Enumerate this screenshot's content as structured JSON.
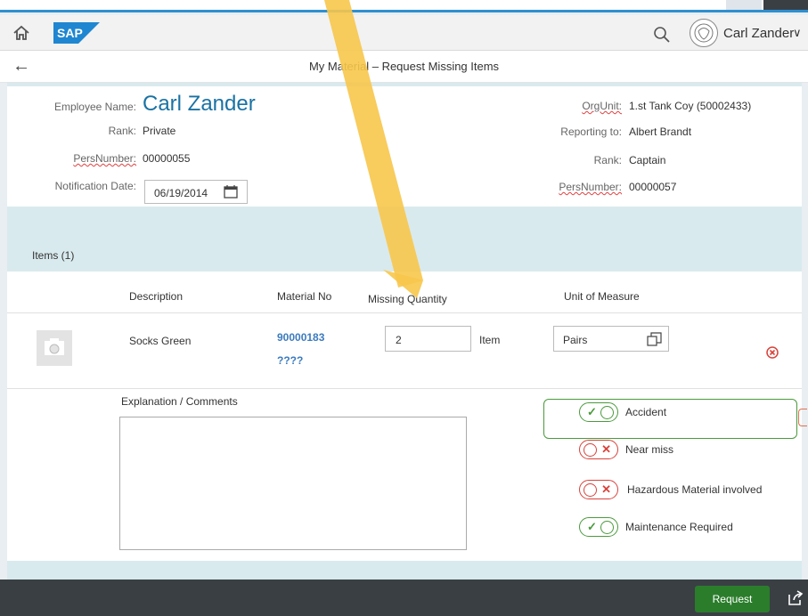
{
  "shell": {
    "logo_text": "SAP",
    "user_name": "Carl Zander",
    "user_menu_chevron": "∨",
    "back_glyph": "←",
    "home_glyph": "⌂"
  },
  "page": {
    "title": "My Material – Request Missing Items"
  },
  "employee": {
    "name_label": "Employee Name:",
    "name_value": "Carl Zander",
    "rank_label": "Rank:",
    "rank_value": "Private",
    "pers_label": "PersNumber:",
    "pers_value": "00000055",
    "date_label": "Notification Date:",
    "date_value": "06/19/2014"
  },
  "manager": {
    "orgunit_label": "OrgUnit:",
    "orgunit_value": "1.st Tank Coy (50002433)",
    "reporting_label": "Reporting to:",
    "reporting_value": "Albert Brandt",
    "rank_label": "Rank:",
    "rank_value": "Captain",
    "pers_label": "PersNumber:",
    "pers_value": "00000057"
  },
  "items": {
    "title": "Items (1)",
    "columns": [
      "Description",
      "Material No",
      "Missing Quantity",
      "Unit of Measure"
    ],
    "rows": [
      {
        "description": "Socks Green",
        "material_no": "90000183",
        "material_sub": "????",
        "quantity": "2",
        "quantity_unit": "Item",
        "uom": "Pairs"
      }
    ]
  },
  "explanation": {
    "label": "Explanation / Comments",
    "value": ""
  },
  "flags": [
    {
      "label": "Accident",
      "state": "on"
    },
    {
      "label": "Near miss",
      "state": "off"
    },
    {
      "label": "Hazardous Material involved",
      "state": "off"
    },
    {
      "label": "Maintenance Required",
      "state": "on"
    }
  ],
  "footer": {
    "request_label": "Request"
  },
  "colors": {
    "accent": "#1a72a3",
    "link": "#3b7bbf",
    "on": "#4a9a3c",
    "off": "#d9423b",
    "footer": "#3a3f44",
    "request": "#2b7d2b",
    "highlight": "#f7c64b"
  },
  "icons": [
    "home-icon",
    "search-icon",
    "avatar",
    "back-icon",
    "calendar-icon",
    "camera-icon",
    "value-help-icon",
    "delete-icon",
    "share-icon"
  ]
}
